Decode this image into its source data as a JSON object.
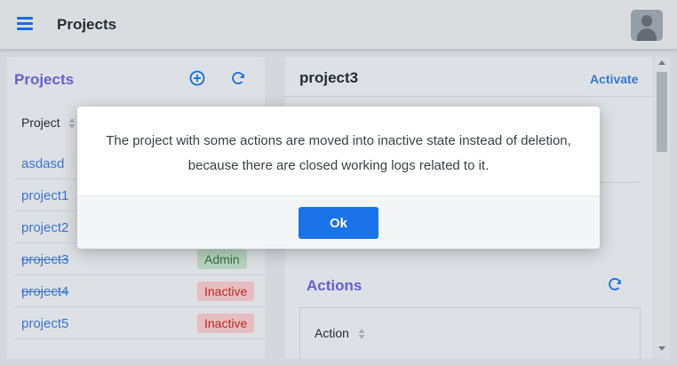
{
  "header": {
    "title": "Projects",
    "menu_icon": "hamburger-menu-icon",
    "avatar_icon": "user-avatar-icon"
  },
  "left_panel": {
    "title": "Projects",
    "add_icon": "add-circle-icon",
    "refresh_icon": "refresh-icon",
    "column_header": "Project",
    "rows": [
      {
        "name": "asdasd",
        "strike": false,
        "badge": ""
      },
      {
        "name": "project1",
        "strike": false,
        "badge": ""
      },
      {
        "name": "project2",
        "strike": false,
        "badge": ""
      },
      {
        "name": "project3",
        "strike": true,
        "badge": "Admin"
      },
      {
        "name": "project4",
        "strike": true,
        "badge": "Inactive"
      },
      {
        "name": "project5",
        "strike": false,
        "badge": "Inactive"
      }
    ]
  },
  "right_panel": {
    "project_name": "project3",
    "activate_label": "Activate",
    "actions_title": "Actions",
    "actions_refresh_icon": "refresh-icon",
    "action_column_header": "Action"
  },
  "dialog": {
    "message": "The project with some actions are moved into inactive state instead of deletion, because there are closed working logs related to it.",
    "ok_label": "Ok"
  },
  "colors": {
    "accent": "#1a73e8",
    "section_title": "#6c63d8",
    "link": "#3b7dd8",
    "admin_bg": "#bfdcc7",
    "inactive_bg": "#efc6c9"
  }
}
